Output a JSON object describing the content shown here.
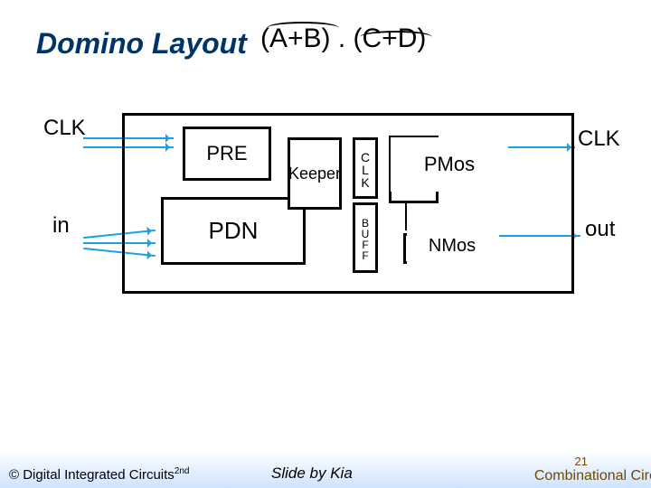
{
  "title": "Domino Layout",
  "expression": "(A+B) . (C+D)",
  "labels": {
    "clk_left": "CLK",
    "in": "in",
    "clk_right": "CLK",
    "out": "out"
  },
  "boxes": {
    "pre": "PRE",
    "pdn": "PDN",
    "keeper": "Keeper",
    "clk_vert": "C\nL\nK",
    "buf_vert": "B\nU\nF\nF",
    "pmos": "PMos",
    "nmos": "NMos"
  },
  "footer": {
    "copyright_pre": "© Digital Integrated Circuits",
    "copyright_sup": "2nd",
    "slide_by": "Slide by Kia",
    "page_number": "21",
    "section": "Combinational Circ"
  },
  "colors": {
    "title": "#003366",
    "arrow": "#1aa0e6",
    "footer_accent": "#6e4a00"
  }
}
